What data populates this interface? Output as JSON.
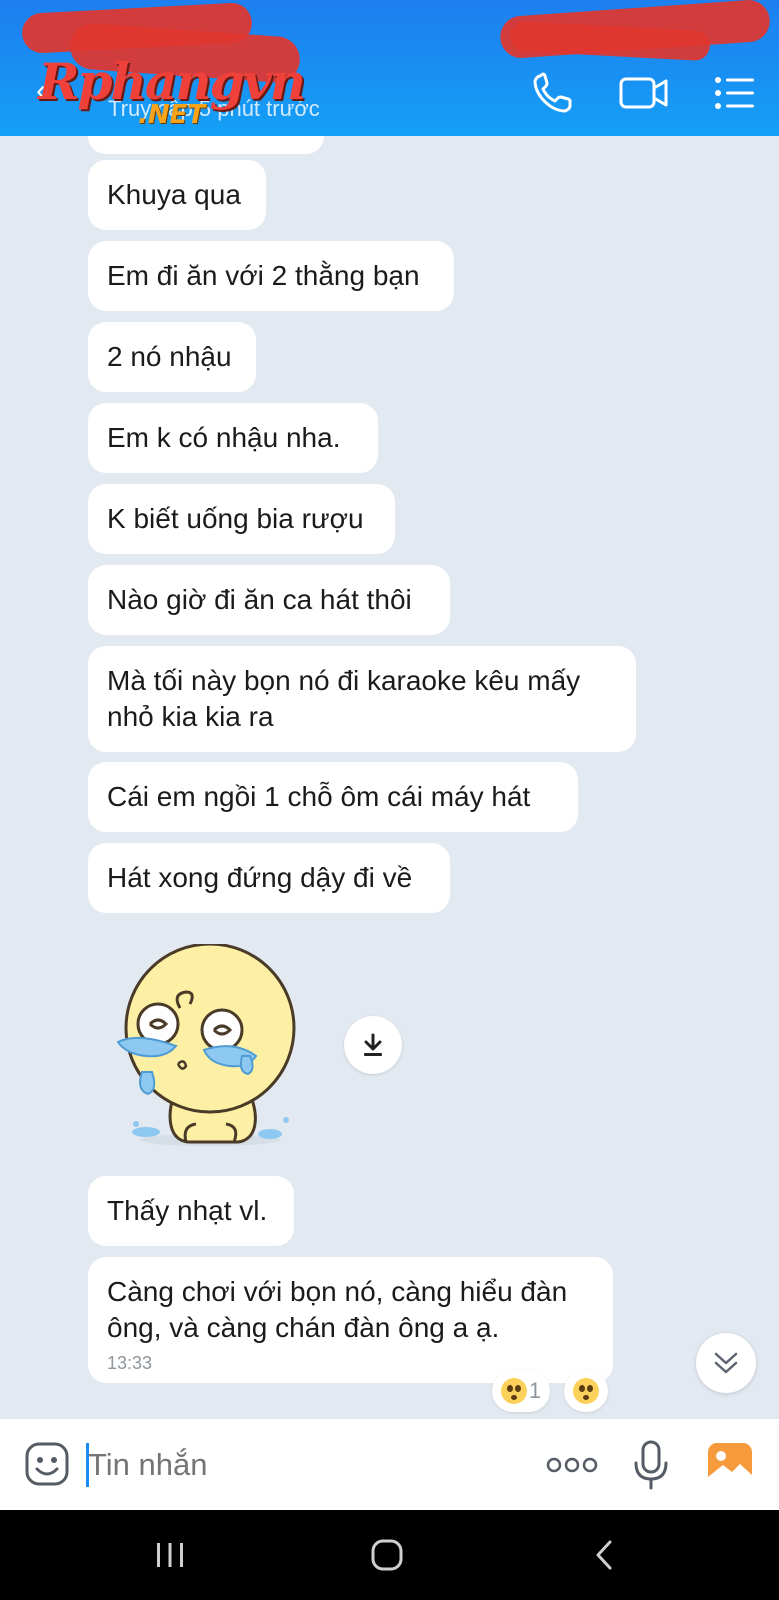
{
  "header": {
    "subtitle": "Truy cập 5 phút trước",
    "watermark_main": "Rphangvn",
    "watermark_net": ".NET",
    "back_icon": "back-arrow-icon",
    "call_icon": "phone-icon",
    "video_icon": "video-camera-icon",
    "menu_icon": "list-menu-icon"
  },
  "messages": [
    {
      "text": "Khuya qua"
    },
    {
      "text": "Em đi ăn với 2 thằng bạn"
    },
    {
      "text": "2 nó nhậu"
    },
    {
      "text": "Em k có nhậu nha."
    },
    {
      "text": "K biết uống bia rượu"
    },
    {
      "text": "Nào giờ đi ăn ca hát thôi"
    },
    {
      "text": "Mà tối này bọn nó đi karaoke kêu mấy nhỏ kia kia ra"
    },
    {
      "text": "Cái em ngồi 1 chỗ ôm cái máy hát"
    },
    {
      "text": "Hát xong đứng dậy đi về"
    },
    {
      "text": "Thấy nhạt vl."
    },
    {
      "text": "Càng chơi với bọn nó, càng hiểu đàn ông, và càng chán đàn ông a ạ.",
      "time": "13:33"
    }
  ],
  "sticker": {
    "name": "crying-yellow-bun-sticker"
  },
  "reactions": {
    "count": "1",
    "icon": "shocked-face-emoji"
  },
  "input": {
    "placeholder": "Tin nhắn"
  },
  "icons": {
    "emoji": "sticker-face-icon",
    "more": "more-dots-icon",
    "mic": "microphone-icon",
    "image": "image-gallery-icon",
    "download": "download-icon",
    "scroll": "double-chevron-down-icon"
  },
  "colors": {
    "header": "#1a8bf2",
    "chat_bg": "#e2e9f1",
    "bubble": "#ffffff",
    "image_icon": "#f79a3c"
  }
}
